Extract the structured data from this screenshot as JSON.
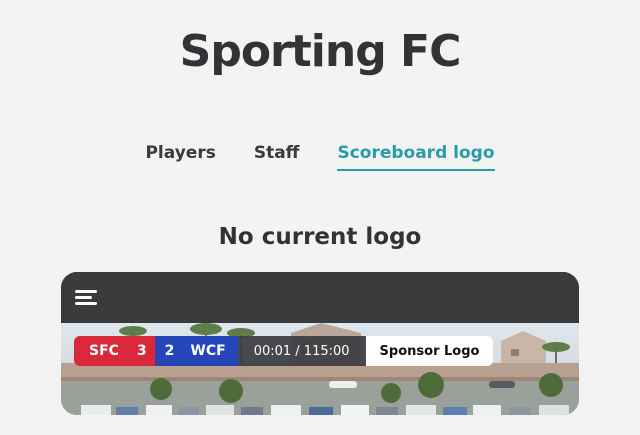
{
  "page": {
    "title": "Sporting FC"
  },
  "tabs": [
    {
      "label": "Players",
      "active": false
    },
    {
      "label": "Staff",
      "active": false
    },
    {
      "label": "Scoreboard logo",
      "active": true
    }
  ],
  "status": {
    "text": "No current logo"
  },
  "preview": {
    "menu_icon": "hamburger-menu-icon",
    "scoreboard": {
      "home_team": "SFC",
      "home_score": "3",
      "away_score": "2",
      "away_team": "WCF",
      "time": "00:01 / 115:00",
      "sponsor": "Sponsor Logo"
    }
  },
  "colors": {
    "accent": "#2a9ca6",
    "home": "#d9283a",
    "away": "#2446b8",
    "bar": "#3a3b3d"
  }
}
